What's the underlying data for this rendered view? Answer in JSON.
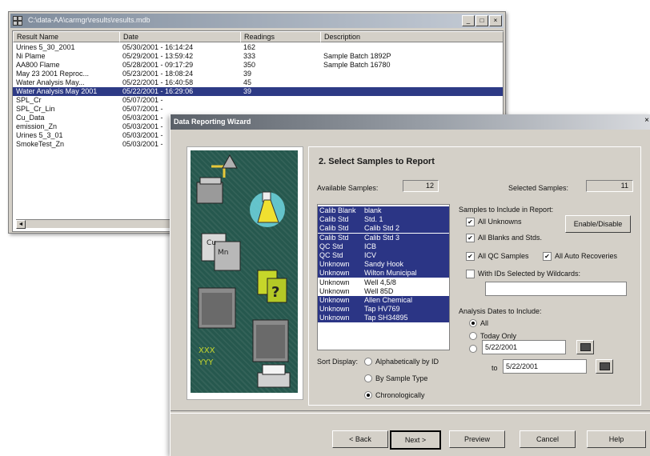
{
  "results_window": {
    "title": "C:\\data-AA\\carmgr\\results\\results.mdb",
    "controls": [
      "_",
      "□",
      "×"
    ],
    "columns": [
      "Result Name",
      "Date",
      "Readings",
      "Description"
    ],
    "rows": [
      {
        "name": "Urines 5_30_2001",
        "date": "05/30/2001 - 16:14:24",
        "readings": "162",
        "description": ""
      },
      {
        "name": "Ni Plame",
        "date": "05/29/2001 - 13:59:42",
        "readings": "333",
        "description": "Sample Batch 1892P"
      },
      {
        "name": "AA800 Flame",
        "date": "05/28/2001 - 09:17:29",
        "readings": "350",
        "description": "Sample Batch 16780"
      },
      {
        "name": "May 23 2001 Reproc...",
        "date": "05/23/2001 - 18:08:24",
        "readings": "39",
        "description": ""
      },
      {
        "name": "Water Analysis May...",
        "date": "05/22/2001 - 16:40:58",
        "readings": "45",
        "description": ""
      },
      {
        "name": "Water Analysis May 2001",
        "date": "05/22/2001 - 16:29:06",
        "readings": "39",
        "description": ""
      },
      {
        "name": "SPL_Cr",
        "date": "05/07/2001 -",
        "readings": "",
        "description": ""
      },
      {
        "name": "SPL_Cr_Lin",
        "date": "05/07/2001 -",
        "readings": "",
        "description": ""
      },
      {
        "name": "Cu_Data",
        "date": "05/03/2001 -",
        "readings": "",
        "description": ""
      },
      {
        "name": "emission_Zn",
        "date": "05/03/2001 -",
        "readings": "",
        "description": ""
      },
      {
        "name": "Urines 5_3_01",
        "date": "05/03/2001 -",
        "readings": "",
        "description": ""
      },
      {
        "name": "SmokeTest_Zn",
        "date": "05/03/2001 -",
        "readings": "",
        "description": ""
      }
    ],
    "selected_row": 5,
    "scroll_left": "◄"
  },
  "wizard": {
    "title": "Data Reporting Wizard",
    "close": "×",
    "step_title": "2. Select Samples to Report",
    "available_label": "Available Samples:",
    "available_count": "12",
    "selected_label": "Selected Samples:",
    "selected_count": "11",
    "samples": [
      {
        "type": "Calib Blank",
        "id": "blank",
        "selected": true
      },
      {
        "type": "Calib Std",
        "id": "Std. 1",
        "selected": true
      },
      {
        "type": "Calib Std",
        "id": "Calib Std 2",
        "selected": true
      },
      {
        "type": "Calib Std",
        "id": "Calib Std 3",
        "selected": true
      },
      {
        "type": "QC Std",
        "id": "ICB",
        "selected": true
      },
      {
        "type": "QC Std",
        "id": "ICV",
        "selected": true
      },
      {
        "type": "Unknown",
        "id": "Sandy Hook",
        "selected": true
      },
      {
        "type": "Unknown",
        "id": "Wilton Municipal",
        "selected": true
      },
      {
        "type": "Unknown",
        "id": "Well 4,5/8",
        "selected": false
      },
      {
        "type": "Unknown",
        "id": "Well 85D",
        "selected": false
      },
      {
        "type": "Unknown",
        "id": "Allen Chemical",
        "selected": true
      },
      {
        "type": "Unknown",
        "id": "Tap HV769",
        "selected": true
      },
      {
        "type": "Unknown",
        "id": "Tap SH34895",
        "selected": true
      }
    ],
    "include_label": "Samples to Include in Report:",
    "include_options": [
      {
        "label": "All Unknowns",
        "checked": true
      },
      {
        "label": "All Blanks and Stds.",
        "checked": true
      },
      {
        "label": "All QC Samples",
        "checked": true
      },
      {
        "label": "All Auto Recoveries",
        "checked": true
      },
      {
        "label": "With IDs Selected by Wildcards:",
        "checked": false
      }
    ],
    "enable_disable": "Enable/Disable",
    "wildcard_value": "",
    "dates_label": "Analysis Dates to Include:",
    "date_options": [
      {
        "label": "All",
        "checked": true
      },
      {
        "label": "Today Only",
        "checked": false
      },
      {
        "label": "",
        "checked": false
      }
    ],
    "date_from": "5/22/2001",
    "to_label": "to",
    "date_to": "5/22/2001",
    "sort_label": "Sort Display:",
    "sort_options": [
      {
        "label": "Alphabetically by ID",
        "checked": false
      },
      {
        "label": "By Sample Type",
        "checked": false
      },
      {
        "label": "Chronologically",
        "checked": true
      }
    ],
    "illustration_labels": [
      "XXX",
      "YYY"
    ],
    "check_mark": "✔",
    "buttons": {
      "back": "< Back",
      "next": "Next >",
      "preview": "Preview",
      "cancel": "Cancel",
      "help": "Help"
    }
  }
}
